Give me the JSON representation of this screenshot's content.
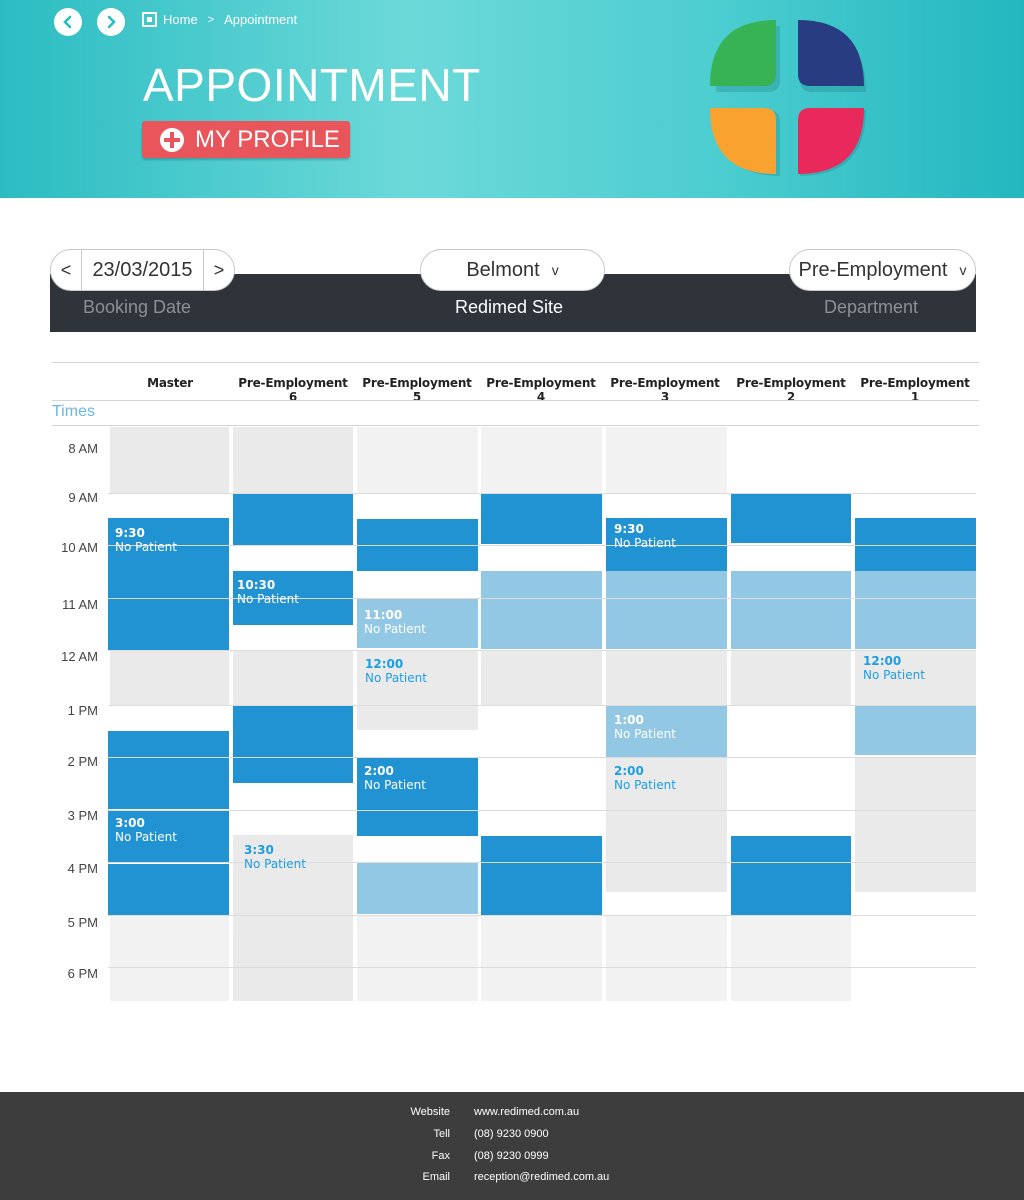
{
  "breadcrumb": {
    "home": "Home",
    "sep": ">",
    "current": "Appointment"
  },
  "header": {
    "title": "APPOINTMENT",
    "profile_button": "MY PROFILE"
  },
  "filters": {
    "date": "23/03/2015",
    "prev": "<",
    "next": ">",
    "site": "Belmont",
    "department": "Pre-Employment",
    "chevron": "v",
    "date_label": "Booking Date",
    "site_label": "Redimed Site",
    "dept_label": "Department"
  },
  "grid": {
    "times_label": "Times",
    "columns": [
      "Master",
      "Pre-Employment 6",
      "Pre-Employment 5",
      "Pre-Employment 4",
      "Pre-Employment 3",
      "Pre-Employment 2",
      "Pre-Employment 1"
    ],
    "hours": [
      "8 AM",
      "9 AM",
      "10 AM",
      "11 AM",
      "12 AM",
      "1 PM",
      "2 PM",
      "3 PM",
      "4 PM",
      "5 PM",
      "6 PM"
    ],
    "appointments": {
      "m1": {
        "time": "9:30",
        "label": "No Patient"
      },
      "m2": {
        "time": "3:00",
        "label": "No Patient"
      },
      "p6a": {
        "time": "10:30",
        "label": "No Patient"
      },
      "p6b": {
        "time": "3:30",
        "label": "No Patient"
      },
      "p5a": {
        "time": "11:00",
        "label": "No Patient"
      },
      "p5b": {
        "time": "12:00",
        "label": "No Patient"
      },
      "p5c": {
        "time": "2:00",
        "label": "No Patient"
      },
      "p3a": {
        "time": "9:30",
        "label": "No Patient"
      },
      "p3b": {
        "time": "1:00",
        "label": "No Patient"
      },
      "p3c": {
        "time": "2:00",
        "label": "No Patient"
      },
      "p1a": {
        "time": "12:00",
        "label": "No Patient"
      }
    }
  },
  "footer": {
    "website_label": "Website",
    "website": "www.redimed.com.au",
    "tel_label": "Tell",
    "tel": "(08) 9230 0900",
    "fax_label": "Fax",
    "fax": "(08) 9230 0999",
    "email_label": "Email",
    "email": "reception@redimed.com.au"
  },
  "colors": {
    "teal": "#4ccdd0",
    "blue": "#2192d2",
    "light_blue": "#93c8e4",
    "red": "#e8555b",
    "dark": "#2f343b"
  }
}
